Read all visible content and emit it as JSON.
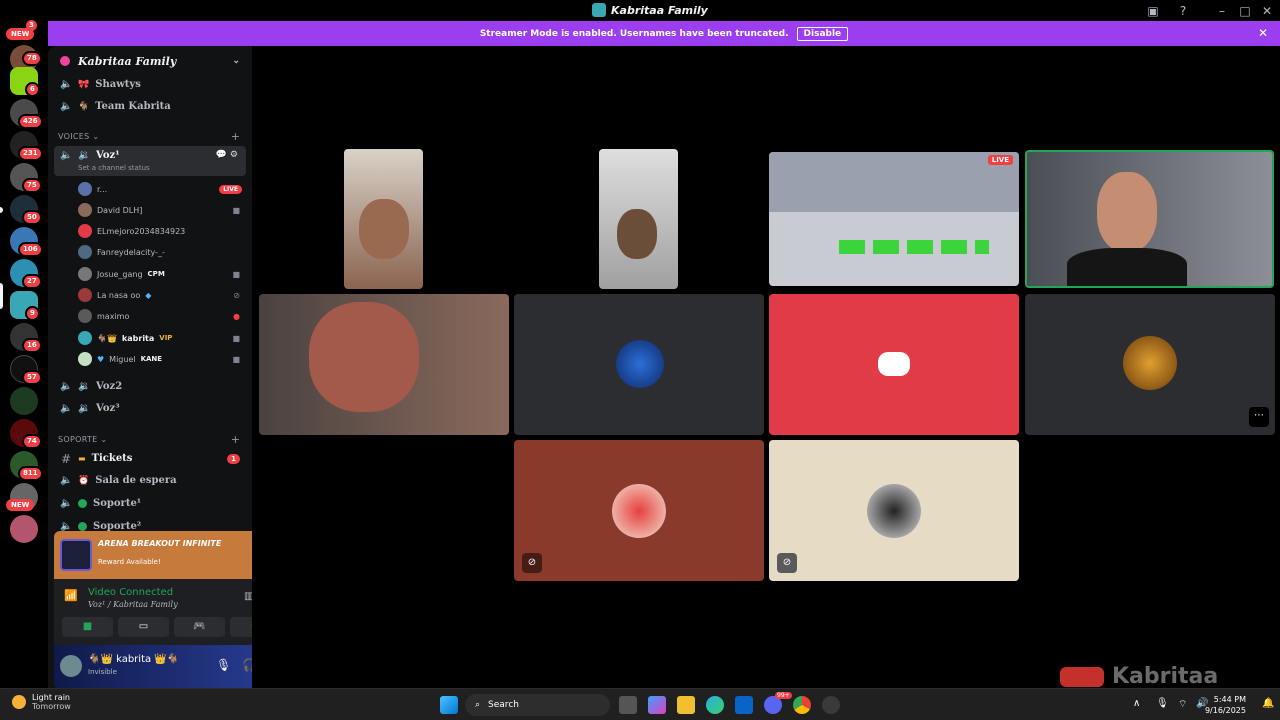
{
  "window": {
    "title": "Kabritaa Family"
  },
  "banner": {
    "text": "Streamer Mode is enabled. Usernames have been truncated.",
    "disable_label": "Disable"
  },
  "rail": {
    "top_badge": "3",
    "items": [
      {
        "badge": "NEW"
      },
      {
        "badge": "78"
      },
      {
        "badge": "6"
      },
      {
        "badge": "426"
      },
      {
        "badge": "231"
      },
      {
        "badge": "75"
      },
      {
        "badge": "50"
      },
      {
        "badge": "106"
      },
      {
        "badge": "27"
      },
      {
        "badge": "9"
      },
      {
        "badge": "16"
      },
      {
        "badge": "57"
      },
      {
        "badge": ""
      },
      {
        "badge": "74"
      },
      {
        "badge": "811"
      },
      {
        "badge": "NEW"
      },
      {
        "badge": ""
      }
    ]
  },
  "sidebar": {
    "server_name": "Kabritaa Family",
    "channels_top": [
      {
        "name": "Shawtys"
      },
      {
        "name": "Team Kabrita"
      }
    ],
    "cat_voices": "VOICES",
    "active_channel": {
      "name": "Voz¹",
      "status": "Set a channel status"
    },
    "participants": [
      {
        "name": "r...",
        "live": "LIVE"
      },
      {
        "name": "David DLH]"
      },
      {
        "name": "ELmejoro2034834923"
      },
      {
        "name": "Fanreydelacity-_-"
      },
      {
        "name": "Josue_gang",
        "tag": "CPM"
      },
      {
        "name": "La nasa oo"
      },
      {
        "name": "maximo"
      },
      {
        "name": "kabrita",
        "tag": "VIP"
      },
      {
        "name": "Miguel",
        "tag": "KANE"
      }
    ],
    "voice_more": [
      {
        "name": "Voz2"
      },
      {
        "name": "Voz³"
      }
    ],
    "cat_support": "SOPORTE",
    "support_channels": [
      {
        "name": "Tickets",
        "badge": "1"
      },
      {
        "name": "Sala de espera"
      },
      {
        "name": "Soporte¹"
      },
      {
        "name": "Soporte²"
      }
    ]
  },
  "reward": {
    "brand": "ARENA BREAKOUT INFINITE",
    "text": "Reward Available!"
  },
  "voice_panel": {
    "status": "Video Connected",
    "channel": "Voz¹ / Kabritaa Family"
  },
  "me": {
    "name": "kabrita",
    "status": "Invisible"
  },
  "stage": {
    "live_label": "LIVE"
  },
  "watermark": {
    "text": "Kabritaa"
  },
  "taskbar": {
    "weather_main": "Light rain",
    "weather_sub": "Tomorrow",
    "search_placeholder": "Search",
    "time": "5:44 PM",
    "date": "9/16/2025",
    "notify_badge": "99+"
  },
  "colors": {
    "accent": "#9b3ef0",
    "discord_red": "#e13b48",
    "online": "#23a55a"
  }
}
